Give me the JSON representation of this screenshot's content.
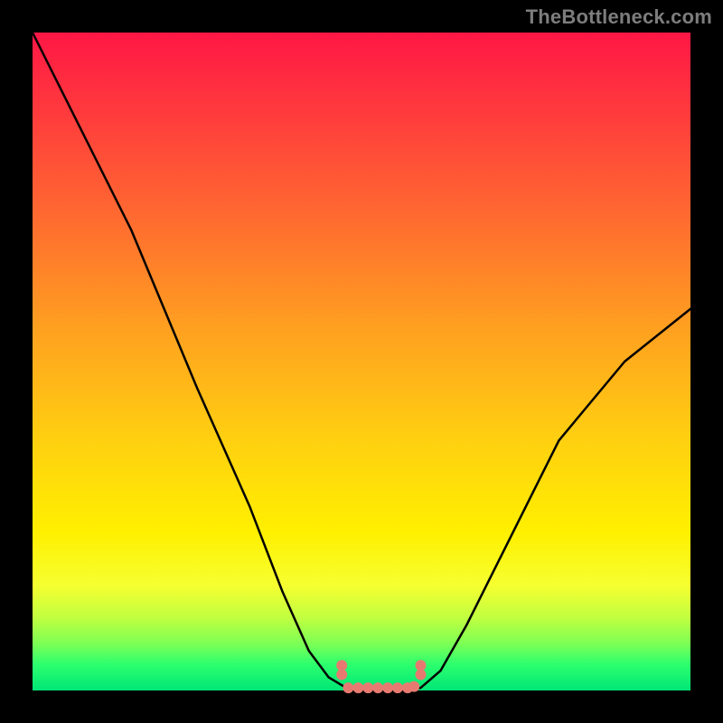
{
  "watermark": "TheBottleneck.com",
  "colors": {
    "frame": "#000000",
    "gradient_top": "#ff1745",
    "gradient_bottom": "#00e676",
    "line": "#000000",
    "markers": "#e77a70",
    "watermark": "#7d7d7d"
  },
  "chart_data": {
    "type": "line",
    "title": "",
    "xlabel": "",
    "ylabel": "",
    "xlim": [
      0,
      100
    ],
    "ylim": [
      0,
      100
    ],
    "grid": false,
    "legend": false,
    "series": [
      {
        "name": "left-descending-branch",
        "x": [
          0,
          15,
          25,
          33,
          38,
          42,
          45,
          47,
          48
        ],
        "values": [
          100,
          70,
          46,
          28,
          15,
          6,
          2,
          0.8,
          0.2
        ]
      },
      {
        "name": "flat-bottom",
        "x": [
          48,
          50,
          52,
          54,
          56,
          58,
          59
        ],
        "values": [
          0.2,
          0,
          0,
          0,
          0,
          0.2,
          0.4
        ]
      },
      {
        "name": "right-ascending-branch",
        "x": [
          59,
          62,
          66,
          72,
          80,
          90,
          100
        ],
        "values": [
          0.4,
          3,
          10,
          22,
          38,
          50,
          58
        ]
      }
    ],
    "markers": [
      {
        "name": "flat-center-cluster",
        "points": [
          {
            "x": 48,
            "y": 0.4
          },
          {
            "x": 49.5,
            "y": 0.4
          },
          {
            "x": 51,
            "y": 0.4
          },
          {
            "x": 52.5,
            "y": 0.4
          },
          {
            "x": 54,
            "y": 0.4
          },
          {
            "x": 55.5,
            "y": 0.4
          },
          {
            "x": 57,
            "y": 0.4
          },
          {
            "x": 58,
            "y": 0.6
          },
          {
            "x": 47,
            "y": 2.4
          },
          {
            "x": 47,
            "y": 3.8
          },
          {
            "x": 59,
            "y": 2.4
          },
          {
            "x": 59,
            "y": 3.8
          }
        ]
      }
    ]
  }
}
